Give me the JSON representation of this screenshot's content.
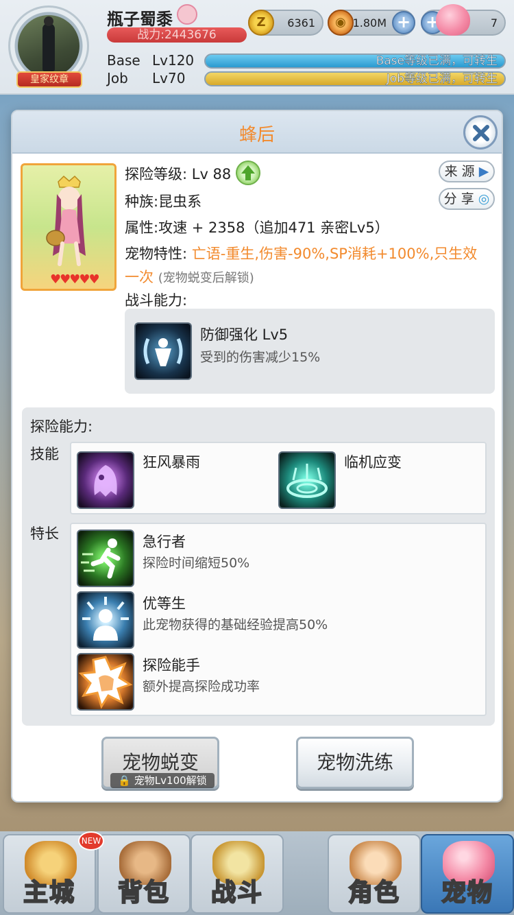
{
  "header": {
    "player_name": "瓶子蜀黍",
    "power": "战力:2443676",
    "title_badge": "皇家纹章",
    "currency_zeny": "6361",
    "currency_coin": "1.80M",
    "currency_third": "7",
    "base_label": "Base",
    "base_level": "Lv120",
    "base_status": "Base等级已满，可转生",
    "job_label": "Job",
    "job_level": "Lv70",
    "job_status": "Job等级已满，可转生"
  },
  "modal": {
    "title": "蜂后",
    "explore_level": "探险等级: Lv 88",
    "race": "种族:昆虫系",
    "attribute": "属性:攻速 + 2358（追加471 亲密Lv5）",
    "trait_key": "宠物特性:",
    "trait_value_line1": "亡语-重生,伤害-90%,SP消耗+100%,只生效",
    "trait_value_line2": "一次",
    "trait_note": "(宠物蜕变后解锁)",
    "combat_title": "战斗能力:",
    "source_button": "来 源",
    "share_button": "分 享",
    "hearts": "♥♥♥♥♥",
    "combat_skill": {
      "name": "防御强化 Lv5",
      "desc": "受到的伤害减少15%"
    },
    "explore_title": "探险能力:",
    "skills_label": "技能",
    "skills": [
      {
        "name": "狂风暴雨"
      },
      {
        "name": "临机应变"
      }
    ],
    "specialty_label": "特长",
    "specialties": [
      {
        "name": "急行者",
        "desc": "探险时间缩短50%"
      },
      {
        "name": "优等生",
        "desc": "此宠物获得的基础经验提高50%"
      },
      {
        "name": "探险能手",
        "desc": "额外提高探险成功率"
      }
    ],
    "evolve_button": "宠物蜕变",
    "evolve_lock": "宠物Lv100解锁",
    "refine_button": "宠物洗练"
  },
  "nav": [
    {
      "label": "主城"
    },
    {
      "label": "背包"
    },
    {
      "label": "战斗"
    },
    {
      "label": "角色"
    },
    {
      "label": "宠物"
    }
  ],
  "new_badge": "NEW",
  "colors": {
    "accent_orange": "#f28a2d",
    "power_red": "#c93a3a",
    "base_bar": "#2a9ad0",
    "job_bar": "#d7a92a"
  }
}
